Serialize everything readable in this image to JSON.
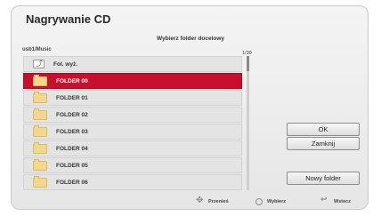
{
  "dialog": {
    "title": "Nagrywanie CD",
    "subtitle": "Wybierz folder docelowy",
    "path": "usb1/Music",
    "page_count": "1/30"
  },
  "list": {
    "items": [
      {
        "label": "Fol. wyż.",
        "icon": "parent-folder-icon",
        "selected": false
      },
      {
        "label": "FOLDER 00",
        "icon": "folder-icon",
        "selected": true
      },
      {
        "label": "FOLDER 01",
        "icon": "folder-icon",
        "selected": false
      },
      {
        "label": "FOLDER 02",
        "icon": "folder-icon",
        "selected": false
      },
      {
        "label": "FOLDER 03",
        "icon": "folder-icon",
        "selected": false
      },
      {
        "label": "FOLDER 04",
        "icon": "folder-icon",
        "selected": false
      },
      {
        "label": "FOLDER 05",
        "icon": "folder-icon",
        "selected": false
      },
      {
        "label": "FOLDER 06",
        "icon": "folder-icon",
        "selected": false
      }
    ]
  },
  "buttons": {
    "ok": "OK",
    "close": "Zamknij",
    "new_folder": "Nowy folder"
  },
  "footer": {
    "move": "Przenieś",
    "select": "Wybierz",
    "back": "Wstecz"
  },
  "colors": {
    "selection": "#c8102e",
    "folder": "#f1d88c"
  }
}
